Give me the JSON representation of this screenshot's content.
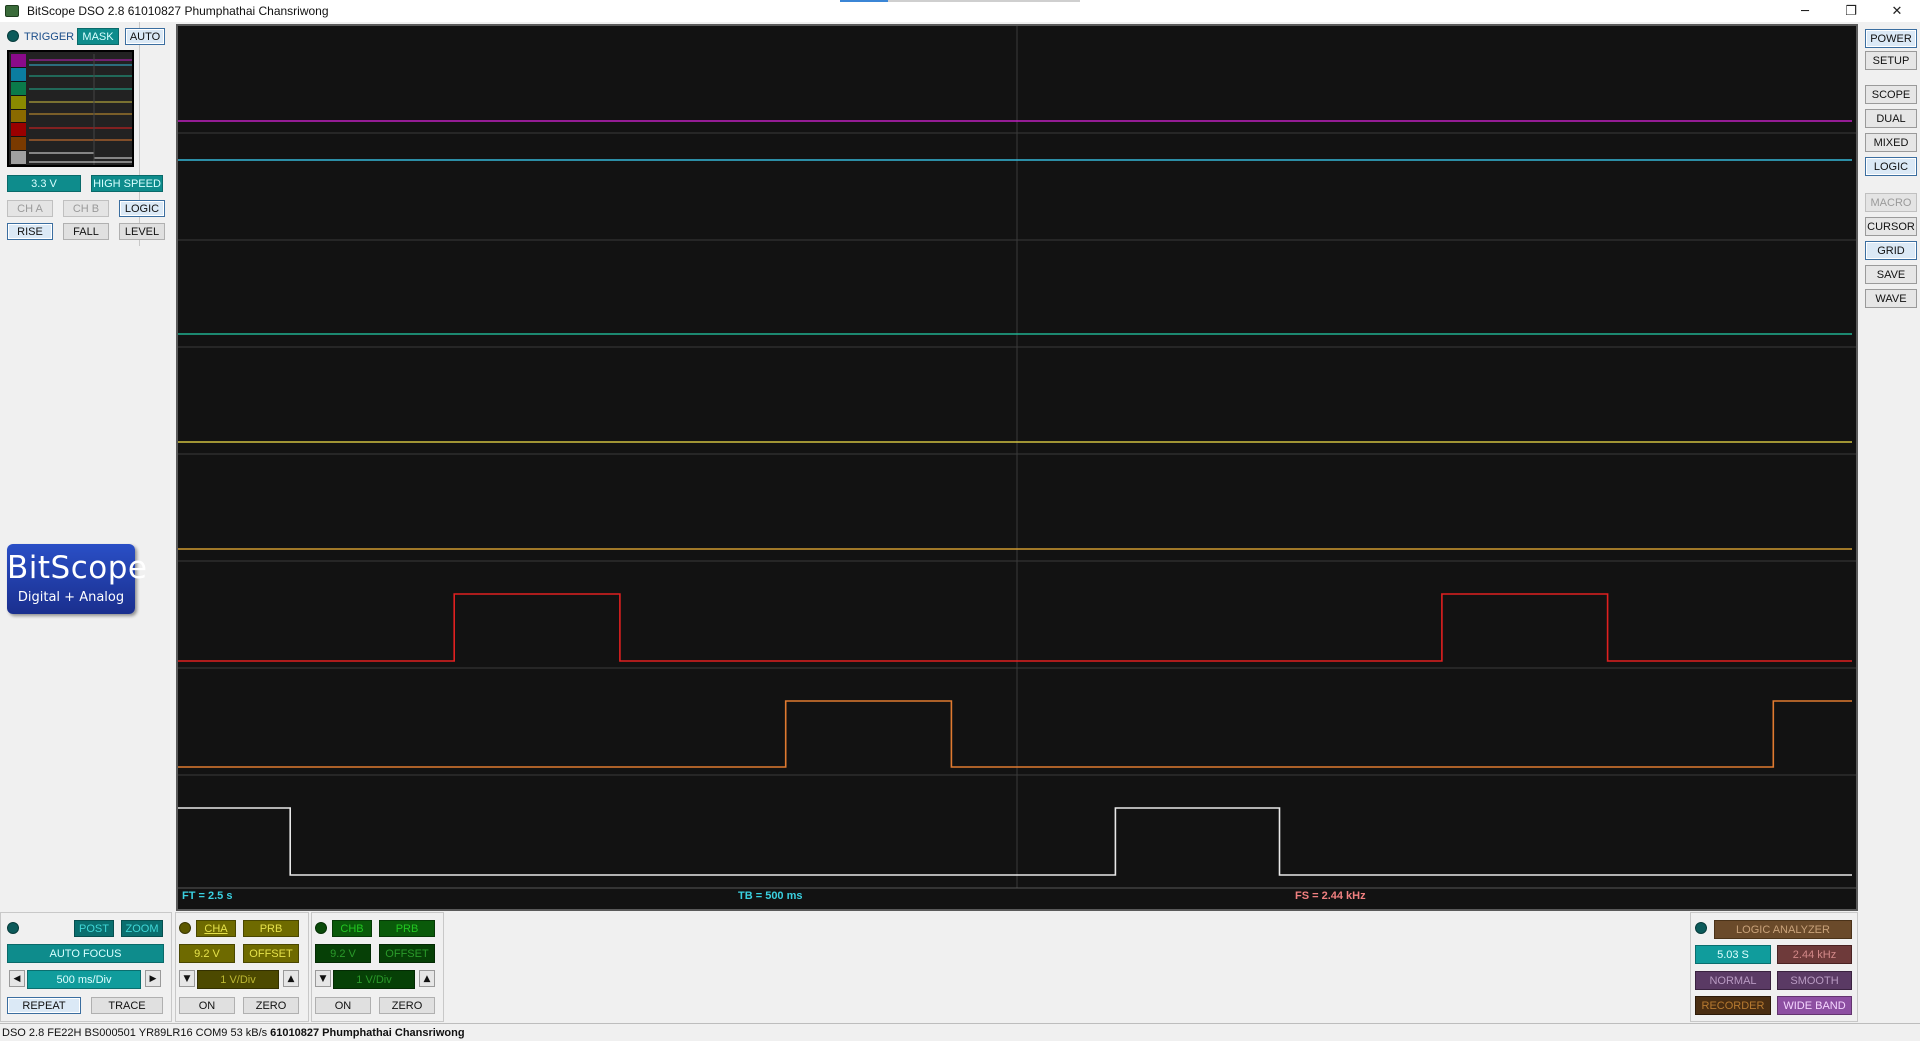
{
  "window": {
    "title": "BitScope DSO 2.8 61010827 Phumphathai Chansriwong",
    "minimize_glyph": "─",
    "restore_glyph": "❐",
    "close_glyph": "✕"
  },
  "trigger": {
    "label": "TRIGGER",
    "mask_label": "MASK",
    "auto_label": "AUTO",
    "voltage_label": "3.3 V",
    "speed_label": "HIGH SPEED",
    "cha_label": "CH A",
    "chb_label": "CH B",
    "logic_label": "LOGIC",
    "rise_label": "RISE",
    "fall_label": "FALL",
    "level_label": "LEVEL",
    "channel_colors": [
      "#8a0a8a",
      "#0b7da0",
      "#0a7a4a",
      "#8a8a00",
      "#8a6a00",
      "#9a0000",
      "#7a3a00",
      "#a0a0a0"
    ]
  },
  "logo": {
    "name": "BitScope",
    "tagline": "Digital + Analog"
  },
  "scope": {
    "ft_label": "FT = 2.5 s",
    "tb_label": "TB = 500 ms",
    "fs_label": "FS = 2.44 kHz",
    "traces": [
      {
        "color": "#c020c0",
        "kind": "flat"
      },
      {
        "color": "#34b8d8",
        "kind": "flat"
      },
      {
        "color": "#20b090",
        "kind": "flat"
      },
      {
        "color": "#d0c040",
        "kind": "flat"
      },
      {
        "color": "#d09a30",
        "kind": "flat"
      },
      {
        "color": "#e02020",
        "kind": "pulse",
        "highs": [
          [
            0.165,
            0.264
          ],
          [
            0.755,
            0.854
          ]
        ]
      },
      {
        "color": "#e07a30",
        "kind": "pulse",
        "highs": [
          [
            0.363,
            0.462
          ],
          [
            0.953,
            1.0
          ]
        ]
      },
      {
        "color": "#e8e8e8",
        "kind": "pulse",
        "highs": [
          [
            0.0,
            0.067
          ],
          [
            0.56,
            0.658
          ]
        ]
      }
    ]
  },
  "right_panel": {
    "power": "POWER",
    "setup": "SETUP",
    "scope": "SCOPE",
    "dual": "DUAL",
    "mixed": "MIXED",
    "logic": "LOGIC",
    "macro": "MACRO",
    "cursor": "CURSOR",
    "grid": "GRID",
    "save": "SAVE",
    "wave": "WAVE"
  },
  "timebase": {
    "post_label": "POST",
    "zoom_label": "ZOOM",
    "auto_focus_label": "AUTO FOCUS",
    "timebase_value": "500 ms/Div",
    "repeat_label": "REPEAT",
    "trace_label": "TRACE"
  },
  "channel_a": {
    "name": "CHA",
    "probe_label": "PRB",
    "range_label": "9.2 V",
    "offset_label": "OFFSET",
    "vdiv_label": "1 V/Div",
    "on_label": "ON",
    "zero_label": "ZERO"
  },
  "channel_b": {
    "name": "CHB",
    "probe_label": "PRB",
    "range_label": "9.2 V",
    "offset_label": "OFFSET",
    "vdiv_label": "1 V/Div",
    "on_label": "ON",
    "zero_label": "ZERO"
  },
  "logic_analyzer": {
    "title": "LOGIC ANALYZER",
    "duration_label": "5.03 S",
    "rate_label": "2.44 kHz",
    "normal_label": "NORMAL",
    "smooth_label": "SMOOTH",
    "recorder_label": "RECORDER",
    "wideband_label": "WIDE BAND"
  },
  "status": {
    "info": "DSO 2.8 FE22H BS000501 YR89LR16 COM9 53 kB/s",
    "owner": "61010827 Phumphathai Chansriwong"
  }
}
